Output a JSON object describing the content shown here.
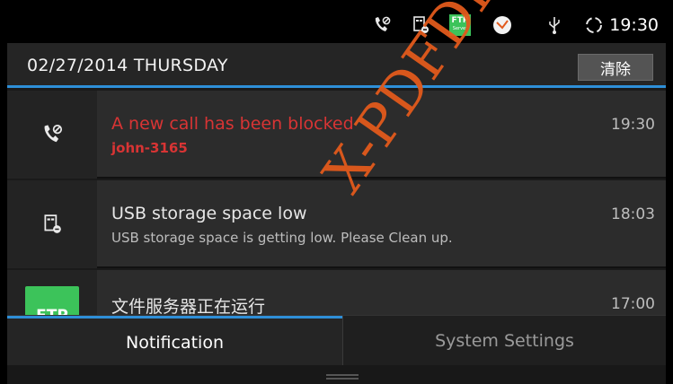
{
  "status_bar": {
    "icons": [
      "call-blocked-icon",
      "storage-low-icon",
      "ftp-server-icon",
      "app-icon",
      "usb-icon",
      "sync-icon"
    ],
    "ftp_label": "FTP",
    "ftp_sublabel": "Server",
    "time": "19:30"
  },
  "header": {
    "date": "02/27/2014 THURSDAY",
    "clear_label": "清除"
  },
  "notifications": [
    {
      "icon": "call-blocked-icon",
      "title": "A new call has been blocked",
      "subtitle": "john-3165",
      "time": "19:30",
      "color": "#d83434"
    },
    {
      "icon": "storage-low-icon",
      "title": "USB storage space low",
      "subtitle": "USB storage space is getting low. Please Clean up.",
      "time": "18:03"
    },
    {
      "icon": "ftp-server-icon",
      "icon_label": "FTP",
      "title": "文件服务器正在运行",
      "time": "17:00"
    }
  ],
  "tabs": {
    "notification": "Notification",
    "system_settings": "System Settings"
  },
  "watermark": "X-PDFDIV",
  "colors": {
    "accent": "#2e8fd8",
    "alert": "#d83434",
    "ftp_green": "#3cc35a",
    "watermark": "#e25a1c"
  }
}
